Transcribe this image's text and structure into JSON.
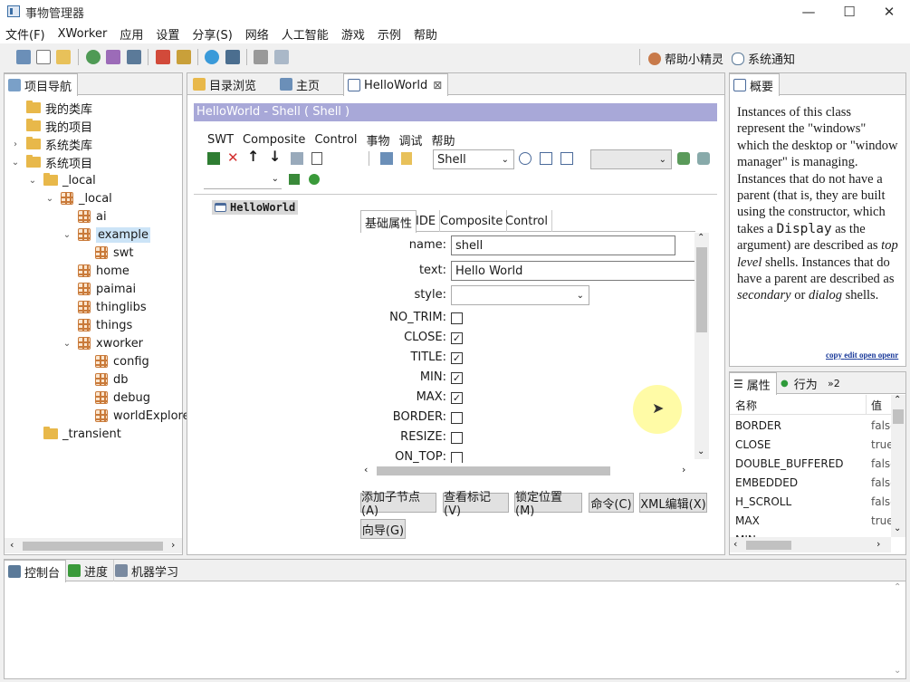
{
  "window": {
    "title": "事物管理器",
    "min": "—",
    "max": "☐",
    "close": "✕"
  },
  "menu": [
    "文件(F)",
    "XWorker",
    "应用",
    "设置",
    "分享(S)",
    "网络",
    "人工智能",
    "游戏",
    "示例",
    "帮助"
  ],
  "toolbar_right": {
    "helper": "帮助小精灵",
    "notify": "系统通知"
  },
  "nav": {
    "tab": "项目导航",
    "items": [
      {
        "label": "我的类库",
        "level": 0,
        "arrow": "",
        "icon": "folder"
      },
      {
        "label": "我的项目",
        "level": 0,
        "arrow": "",
        "icon": "folder"
      },
      {
        "label": "系统类库",
        "level": 0,
        "arrow": "›",
        "icon": "folder"
      },
      {
        "label": "系统项目",
        "level": 0,
        "arrow": "⌄",
        "icon": "folder"
      },
      {
        "label": "_local",
        "level": 1,
        "arrow": "⌄",
        "icon": "folder"
      },
      {
        "label": "_local",
        "level": 2,
        "arrow": "⌄",
        "icon": "pkg"
      },
      {
        "label": "ai",
        "level": 3,
        "arrow": "",
        "icon": "pkg"
      },
      {
        "label": "example",
        "level": 3,
        "arrow": "⌄",
        "icon": "pkg",
        "selected": true
      },
      {
        "label": "swt",
        "level": 4,
        "arrow": "",
        "icon": "pkg"
      },
      {
        "label": "home",
        "level": 3,
        "arrow": "",
        "icon": "pkg"
      },
      {
        "label": "paimai",
        "level": 3,
        "arrow": "",
        "icon": "pkg"
      },
      {
        "label": "thinglibs",
        "level": 3,
        "arrow": "",
        "icon": "pkg"
      },
      {
        "label": "things",
        "level": 3,
        "arrow": "",
        "icon": "pkg"
      },
      {
        "label": "xworker",
        "level": 3,
        "arrow": "⌄",
        "icon": "pkg"
      },
      {
        "label": "config",
        "level": 4,
        "arrow": "",
        "icon": "pkg"
      },
      {
        "label": "db",
        "level": 4,
        "arrow": "",
        "icon": "pkg"
      },
      {
        "label": "debug",
        "level": 4,
        "arrow": "",
        "icon": "pkg"
      },
      {
        "label": "worldExplorer",
        "level": 4,
        "arrow": "",
        "icon": "pkg"
      },
      {
        "label": "_transient",
        "level": 1,
        "arrow": "",
        "icon": "folder"
      }
    ]
  },
  "editor": {
    "tabs": [
      "目录浏览",
      "主页",
      "HelloWorld"
    ],
    "tab_close": "⊠",
    "header": "HelloWorld - Shell ( Shell )",
    "menu": [
      "SWT",
      "Composite",
      "Control",
      "事物",
      "调试",
      "帮助"
    ],
    "type_select": "Shell",
    "tree_node": "HelloWorld",
    "form_tabs": [
      "基础属性",
      "IDE",
      "Composite",
      "Control"
    ],
    "fields": [
      {
        "label": "name:",
        "value": "shell"
      },
      {
        "label": "text:",
        "value": "Hello World"
      },
      {
        "label": "style:",
        "value": ""
      }
    ],
    "checks": [
      {
        "label": "NO_TRIM:",
        "checked": false
      },
      {
        "label": "CLOSE:",
        "checked": true
      },
      {
        "label": "TITLE:",
        "checked": true
      },
      {
        "label": "MIN:",
        "checked": true
      },
      {
        "label": "MAX:",
        "checked": true
      },
      {
        "label": "BORDER:",
        "checked": false
      },
      {
        "label": "RESIZE:",
        "checked": false
      },
      {
        "label": "ON_TOP:",
        "checked": false
      }
    ],
    "check_mark": "✓",
    "buttons": [
      "添加子节点(A)",
      "查看标记(V)",
      "锁定位置(M)",
      "命令(C)",
      "XML编辑(X)",
      "向导(G)"
    ]
  },
  "overview": {
    "tab": "概要",
    "text_html": "Instances of this class represent the \"windows\" which the desktop or \"window manager\" is managing. Instances that do not have a parent (that is, they are built using the constructor, which takes a <code>Display</code> as the argument) are described as <i>top level</i> shells. Instances that do have a parent are described as <i>secondary</i> or <i>dialog</i> shells.",
    "links": [
      "copy",
      "edit",
      "open",
      "openr"
    ]
  },
  "props": {
    "tabs": [
      "属性",
      "行为",
      "»2"
    ],
    "col_name": "名称",
    "col_value": "值",
    "rows": [
      {
        "name": "BORDER",
        "value": "false"
      },
      {
        "name": "CLOSE",
        "value": "true"
      },
      {
        "name": "DOUBLE_BUFFERED",
        "value": "false"
      },
      {
        "name": "EMBEDDED",
        "value": "false"
      },
      {
        "name": "H_SCROLL",
        "value": "false"
      },
      {
        "name": "MAX",
        "value": "true"
      },
      {
        "name": "MIN",
        "value": ""
      }
    ]
  },
  "console": {
    "tabs": [
      "控制台",
      "进度",
      "机器学习"
    ]
  }
}
